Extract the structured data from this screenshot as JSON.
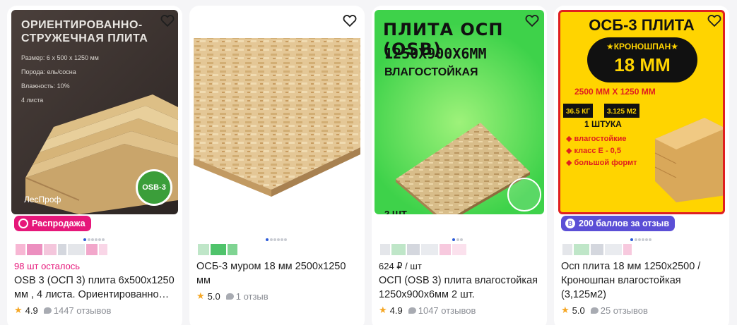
{
  "cards": [
    {
      "image": {
        "heading": "ОРИЕНТИРОВАННО-\nСТРУЖЕЧНАЯ ПЛИТА",
        "specs": [
          "Размер: 6 х 500 х 1250 мм",
          "Порода: ель/сосна",
          "Влажность: 10%",
          "4 листа"
        ],
        "brand": "ЛесПроф",
        "stamp": "OSB-3"
      },
      "badge": "Распродажа",
      "meta": "98 шт осталось",
      "title": "OSB 3 (ОСП 3) плита 6х500х1250 мм , 4 листа. Ориентированно…",
      "rating": "4.9",
      "reviews": "1447 отзывов"
    },
    {
      "title": "ОСБ-3 муром 18 мм 2500х1250 мм",
      "rating": "5.0",
      "reviews": "1 отзыв"
    },
    {
      "image": {
        "line1": "ПЛИТА ОСП (OSB)",
        "line2": "1250Х900Х6ММ",
        "line3": "ВЛАГОСТОЙКАЯ",
        "qty": "2 ШТ."
      },
      "meta": "624 ₽ / шт",
      "title": "ОСП (OSB 3) плита влагостойкая 1250х900х6мм 2 шт.",
      "rating": "4.9",
      "reviews": "1047 отзывов"
    },
    {
      "image": {
        "line1": "ОСБ-3 ПЛИТА",
        "brand": "★КРОНОШПАН★",
        "thickness": "18 ММ",
        "size": "2500 ММ Х 1250 ММ",
        "weight": "36.5 КГ",
        "area": "3.125 М2",
        "qty": "1 ШТУКА",
        "features": [
          "влагостойкие",
          "класс Е - 0,5",
          "большой формт"
        ]
      },
      "badge": "200 баллов за отзыв",
      "title": "Осп плита 18 мм 1250х2500 / Кроношпан влагостойкая (3,125м2)",
      "rating": "5.0",
      "reviews": "25 отзывов"
    }
  ],
  "colors": {
    "sale_badge": "#e6177a",
    "points_badge": "#5b4fd6",
    "meta_pink": "#e6177a",
    "star": "#f5a623",
    "accent_blue": "#2d5bd8"
  }
}
